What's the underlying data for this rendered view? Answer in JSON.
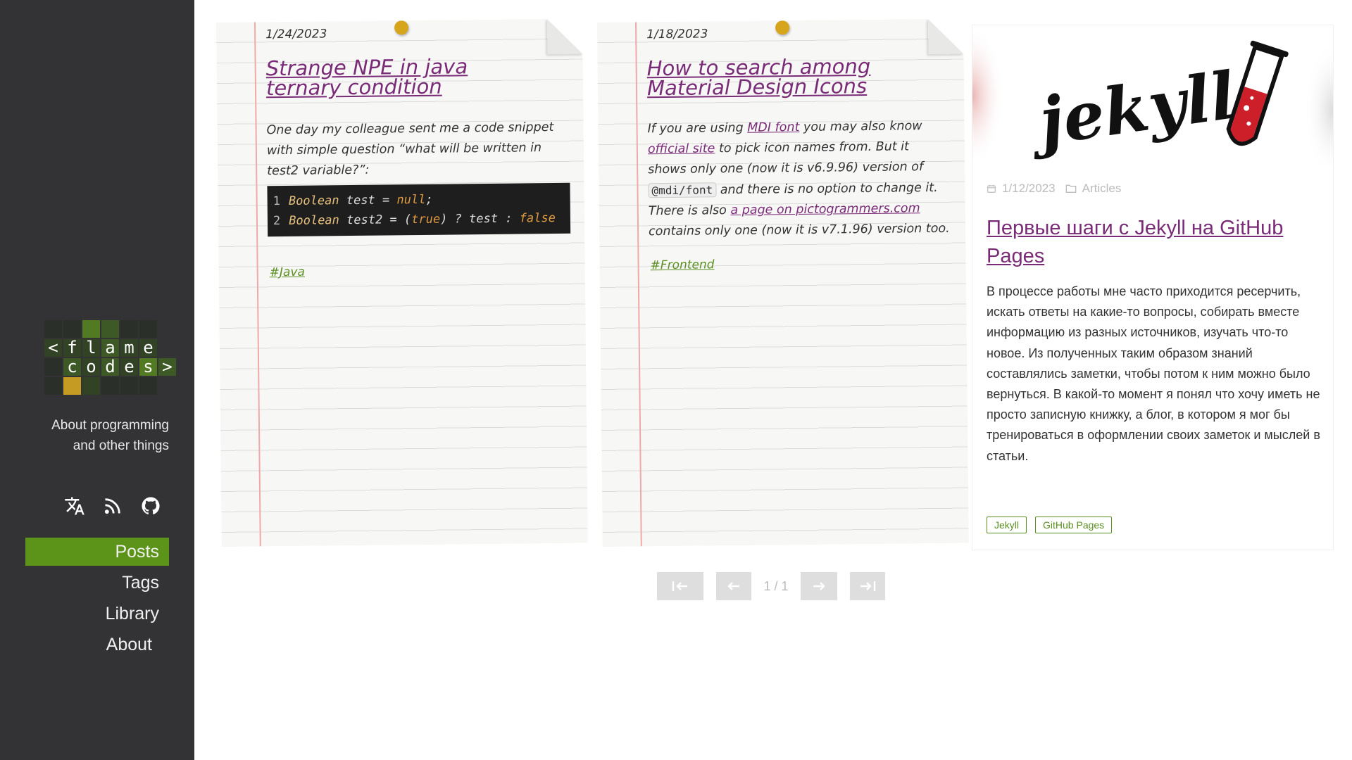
{
  "sidebar": {
    "logo": {
      "row1": [
        "<",
        "f",
        "l",
        "a",
        "m",
        "e"
      ],
      "row2": [
        "",
        "c",
        "o",
        "d",
        "e",
        "s",
        ">"
      ]
    },
    "tagline_line1": "About programming",
    "tagline_line2": "and other things",
    "social": [
      "translate-icon",
      "rss-icon",
      "github-icon"
    ],
    "nav": [
      {
        "label": "Posts",
        "active": true
      },
      {
        "label": "Tags",
        "active": false
      },
      {
        "label": "Library",
        "active": false
      },
      {
        "label": "About",
        "active": false
      }
    ]
  },
  "posts": [
    {
      "date": "1/24/2023",
      "title": "Strange NPE in java ternary condition",
      "excerpt": "One day my colleague sent me a code snippet with simple question “what will be written in test2 variable?”:",
      "code": {
        "line1": {
          "num": "1",
          "type": "Boolean",
          "rest": " test = ",
          "lit": "null",
          "end": ";"
        },
        "line2": {
          "num": "2",
          "type": "Boolean",
          "rest": " test2 = (",
          "lit": "true",
          "mid": ") ? test : ",
          "lit2": "false"
        }
      },
      "tag": "#Java"
    },
    {
      "date": "1/18/2023",
      "title": "How to search among Material Design Icons",
      "excerpt": {
        "p1": "If you are using ",
        "link1": "MDI font",
        "p2": " you may also know ",
        "link2": "official site",
        "p3": " to pick icon names from. But it shows only one (now it is v6.9.96) version of ",
        "code": "@mdi/font",
        "p4": " and there is no option to change it. There is also ",
        "link3": "a page on pictogrammers.com",
        "p5": " contains only one (now it is v7.1.96) version too."
      },
      "tag": "#Frontend"
    },
    {
      "image_caption": "jekyll",
      "date": "1/12/2023",
      "category": "Articles",
      "title": "Первые шаги с Jekyll на GitHub Pages",
      "text": "В процессе работы мне часто приходится ресерчить, искать ответы на какие-то вопросы, собирать вместе информацию из разных источников, изучать что-то новое. Из полученных таким образом знаний составлялись заметки, чтобы потом к ним можно было вернуться. В какой-то момент я понял что хочу иметь не просто записную книжку, а блог, в котором я мог бы тренироваться в оформлении своих заметок и мыслей в статьи.",
      "tags": [
        "Jekyll",
        "GitHub Pages"
      ]
    }
  ],
  "pagination": {
    "label": "1 / 1",
    "buttons": [
      "first-page-icon",
      "prev-page-icon",
      "next-page-icon",
      "last-page-icon"
    ]
  },
  "colors": {
    "sidebar": "#333335",
    "accent_green": "#5c9419",
    "link_purple": "#7a2b77",
    "pin_yellow": "#d7a51b"
  }
}
